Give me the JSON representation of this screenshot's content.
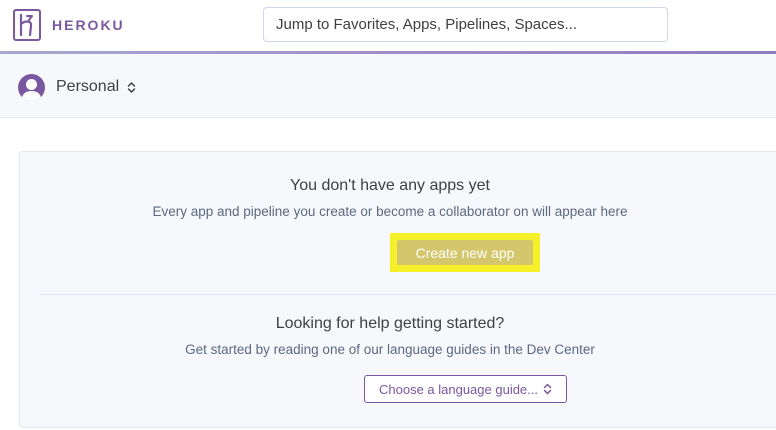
{
  "header": {
    "brand_name": "HEROKU",
    "logo_icon": "heroku-logo-icon",
    "search_placeholder": "Jump to Favorites, Apps, Pipelines, Spaces..."
  },
  "account": {
    "name": "Personal",
    "avatar_icon": "user-avatar-icon",
    "switcher_icon": "chevron-updown-icon"
  },
  "empty_apps": {
    "title": "You don't have any apps yet",
    "description": "Every app and pipeline you create or become a collaborator on will appear here",
    "create_button_label": "Create new app"
  },
  "help": {
    "title": "Looking for help getting started?",
    "description": "Get started by reading one of our language guides in the Dev Center",
    "language_select_label": "Choose a language guide..."
  },
  "colors": {
    "brand": "#79589f",
    "highlight": "#f5f02a",
    "button_bg": "#d3c66b",
    "panel_bg": "#f7f8fb",
    "text": "#3f3f44",
    "muted_text": "#596981"
  }
}
